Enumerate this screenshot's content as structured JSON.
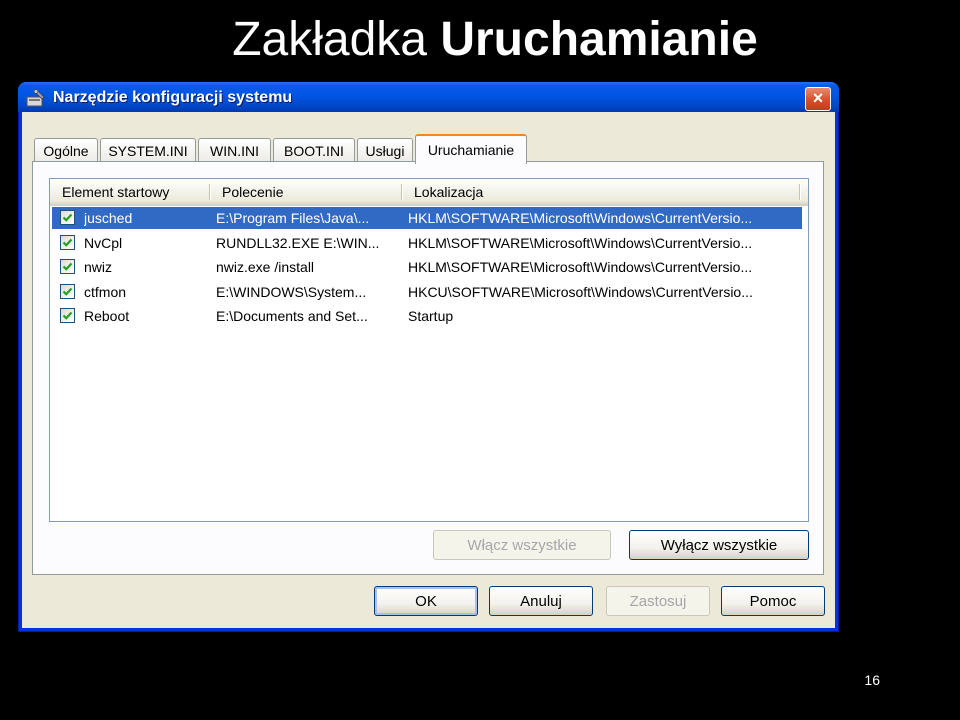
{
  "slide": {
    "title_normal": "Zakładka",
    "title_bold": "Uruchamianie",
    "page_number": "16"
  },
  "window": {
    "title": "Narzędzie konfiguracji systemu",
    "icon": "msconfig-icon",
    "close_label": "×"
  },
  "tabs": [
    {
      "label": "Ogólne"
    },
    {
      "label": "SYSTEM.INI"
    },
    {
      "label": "WIN.INI"
    },
    {
      "label": "BOOT.INI"
    },
    {
      "label": "Usługi"
    },
    {
      "label": "Uruchamianie"
    }
  ],
  "active_tab": "Uruchamianie",
  "list": {
    "columns": [
      "Element startowy",
      "Polecenie",
      "Lokalizacja"
    ],
    "rows": [
      {
        "checked": true,
        "name": "jusched",
        "command": "E:\\Program Files\\Java\\...",
        "location": "HKLM\\SOFTWARE\\Microsoft\\Windows\\CurrentVersio...",
        "selected": true
      },
      {
        "checked": true,
        "name": "NvCpl",
        "command": "RUNDLL32.EXE E:\\WIN...",
        "location": "HKLM\\SOFTWARE\\Microsoft\\Windows\\CurrentVersio...",
        "selected": false
      },
      {
        "checked": true,
        "name": "nwiz",
        "command": "nwiz.exe /install",
        "location": "HKLM\\SOFTWARE\\Microsoft\\Windows\\CurrentVersio...",
        "selected": false
      },
      {
        "checked": true,
        "name": "ctfmon",
        "command": "E:\\WINDOWS\\System...",
        "location": "HKCU\\SOFTWARE\\Microsoft\\Windows\\CurrentVersio...",
        "selected": false
      },
      {
        "checked": true,
        "name": "Reboot",
        "command": "E:\\Documents and Set...",
        "location": "Startup",
        "selected": false
      }
    ]
  },
  "panel_buttons": {
    "enable_all": "Włącz wszystkie",
    "disable_all": "Wyłącz wszystkie"
  },
  "dialog_buttons": {
    "ok": "OK",
    "cancel": "Anuluj",
    "apply": "Zastosuj",
    "help": "Pomoc"
  },
  "colors": {
    "titlebar": "#0055e5",
    "selection": "#316ac5",
    "active_tab_accent": "#e68b2c",
    "client_bg": "#ece9d8"
  }
}
